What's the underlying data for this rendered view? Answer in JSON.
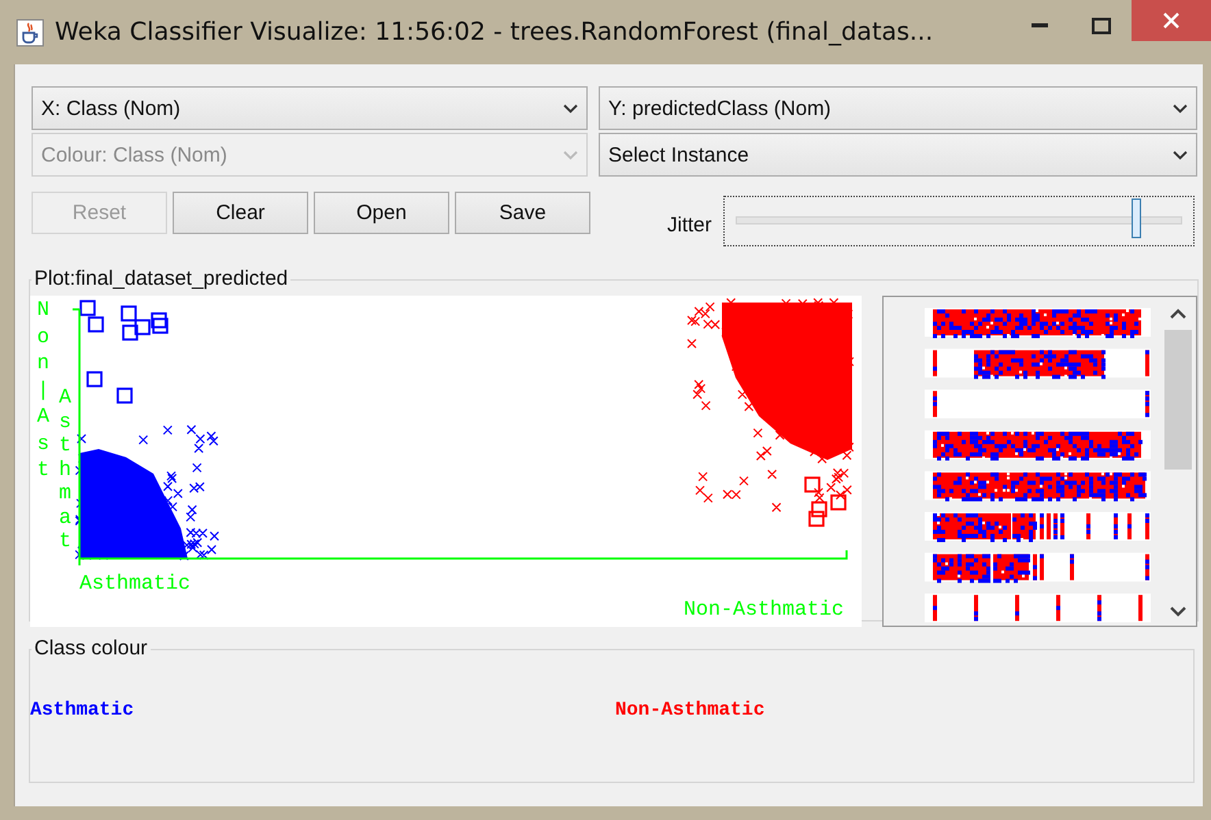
{
  "window": {
    "title": "Weka Classifier Visualize: 11:56:02 - trees.RandomForest (final_datas..."
  },
  "selectors": [
    {
      "label": "X: Class (Nom)",
      "disabled": false
    },
    {
      "label": "Y: predictedClass (Nom)",
      "disabled": false
    },
    {
      "label": "Colour: Class (Nom)",
      "disabled": true
    },
    {
      "label": "Select Instance",
      "disabled": false
    }
  ],
  "buttons": [
    {
      "label": "Reset",
      "disabled": true
    },
    {
      "label": "Clear",
      "disabled": false
    },
    {
      "label": "Open",
      "disabled": false
    },
    {
      "label": "Save",
      "disabled": false
    }
  ],
  "jitter": {
    "label": "Jitter",
    "level": 0.9
  },
  "plot": {
    "title": "Plot:final_dataset_predicted",
    "x_axis": {
      "low": "Asthmatic",
      "high": "Non-Asthmatic"
    },
    "y_axis": {
      "high": "Non|Ast",
      "low": "Asthmat"
    }
  },
  "class_colour": {
    "title": "Class colour",
    "classes": [
      {
        "name": "Asthmatic",
        "color": "#0000ff"
      },
      {
        "name": "Non-Asthmatic",
        "color": "#ff0000"
      }
    ]
  }
}
